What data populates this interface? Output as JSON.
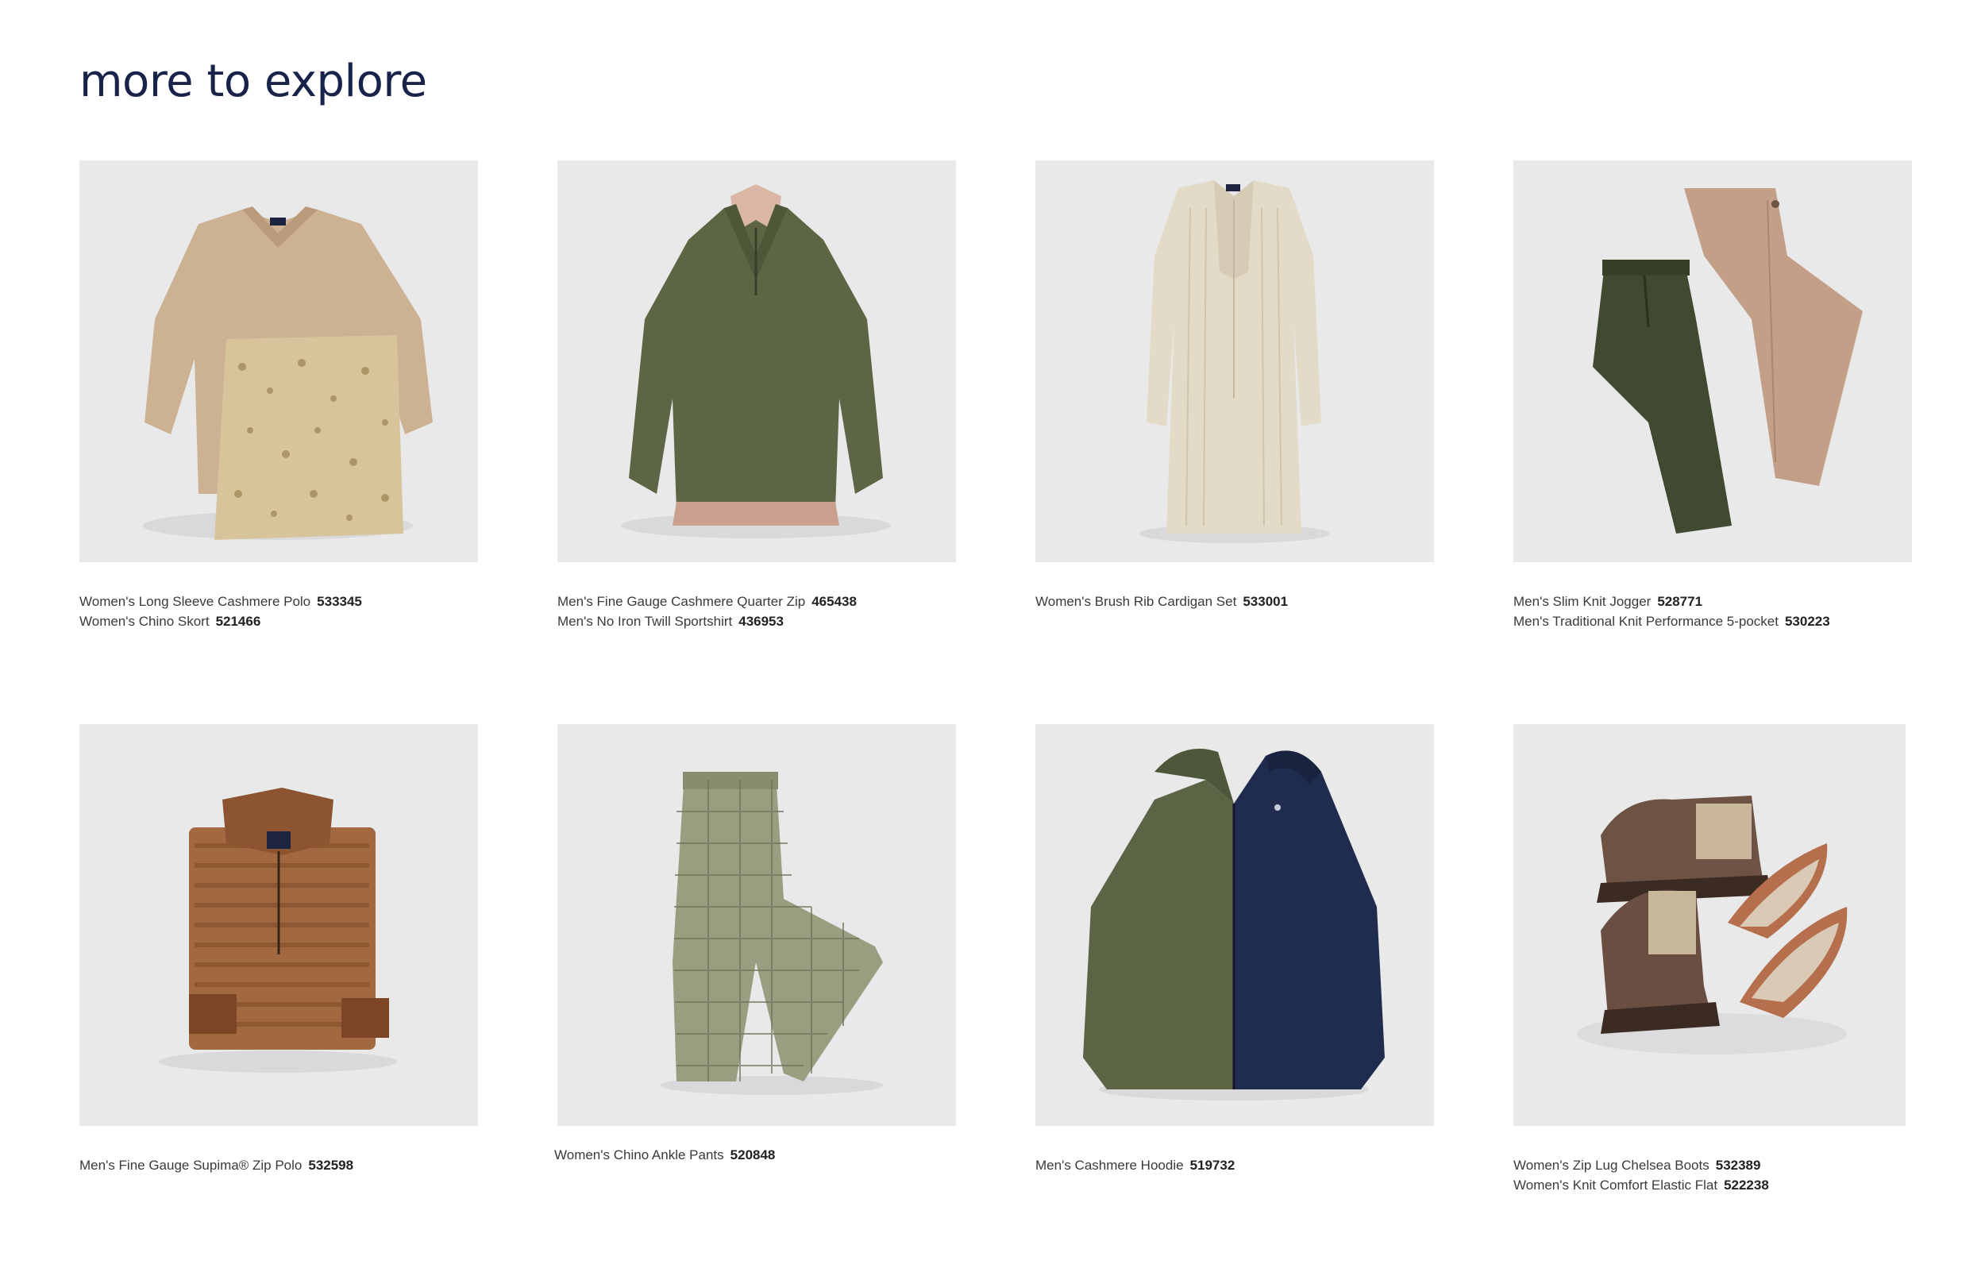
{
  "page": {
    "title": "more to explore"
  },
  "products": [
    {
      "items": [
        {
          "name": "Women's Long Sleeve Cashmere Polo",
          "sku": "533345"
        },
        {
          "name": "Women's Chino Skort",
          "sku": "521466"
        }
      ]
    },
    {
      "items": [
        {
          "name": "Men's Fine Gauge Cashmere Quarter Zip",
          "sku": "465438"
        },
        {
          "name": "Men's No Iron Twill Sportshirt",
          "sku": "436953"
        }
      ]
    },
    {
      "items": [
        {
          "name": "Women's Brush Rib Cardigan Set",
          "sku": "533001"
        }
      ]
    },
    {
      "items": [
        {
          "name": "Men's Slim Knit Jogger",
          "sku": "528771"
        },
        {
          "name": "Men's Traditional Knit Performance 5-pocket",
          "sku": "530223"
        }
      ]
    },
    {
      "items": [
        {
          "name": "Men's Fine Gauge Supima® Zip Polo",
          "sku": "532598"
        }
      ]
    },
    {
      "items": [
        {
          "name": "Women's Chino Ankle Pants",
          "sku": "520848"
        }
      ]
    },
    {
      "items": [
        {
          "name": "Men's Cashmere Hoodie",
          "sku": "519732"
        }
      ]
    },
    {
      "items": [
        {
          "name": "Women's Zip Lug Chelsea Boots",
          "sku": "532389"
        },
        {
          "name": "Women's Knit Comfort Elastic Flat",
          "sku": "522238"
        }
      ]
    }
  ],
  "colors": {
    "title": "#18234a",
    "tile_background": "#e9e9ea",
    "caption_text": "#3a3a3a"
  }
}
